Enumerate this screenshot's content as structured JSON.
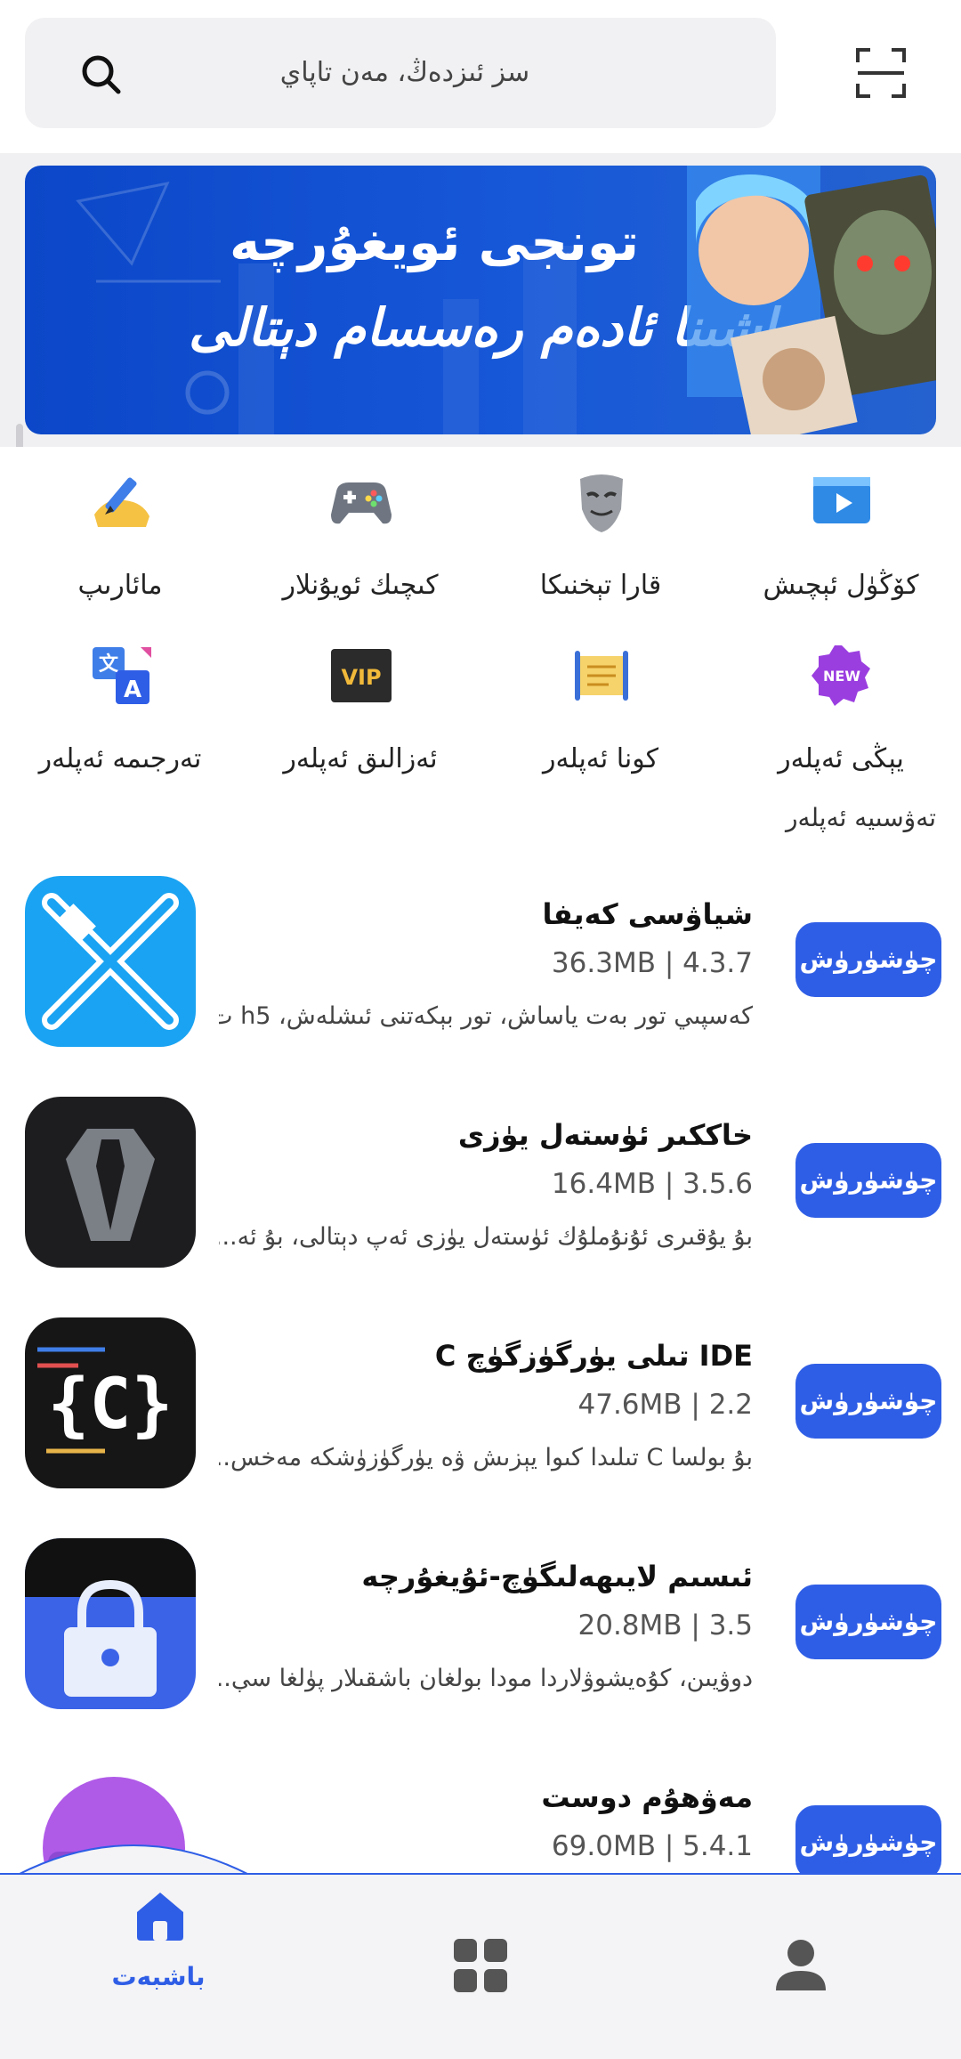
{
  "header": {
    "search_placeholder": "سز ئىزدەڭ، مەن تاپاي",
    "search_icon": "search-icon",
    "scan_icon": "scan-icon"
  },
  "banner": {
    "title": "تونجى ئويغۇرچە",
    "subtitle": "ماشىنا ئادەم رەسسام دېتالى"
  },
  "categories": [
    {
      "label": "كۆڭۈل ئېچىش",
      "icon": "video-icon"
    },
    {
      "label": "قارا تېخنىكا",
      "icon": "mask-icon"
    },
    {
      "label": "كىچىك ئويۇنلار",
      "icon": "gamepad-icon"
    },
    {
      "label": "مائارىپ",
      "icon": "pen-icon"
    },
    {
      "label": "يېڭى ئەپلەر",
      "icon": "new-badge-icon"
    },
    {
      "label": "كونا ئەپلەر",
      "icon": "scroll-icon"
    },
    {
      "label": "ئەزالىق ئەپلەر",
      "icon": "vip-icon"
    },
    {
      "label": "تەرجىمە ئەپلەر",
      "icon": "translate-icon"
    }
  ],
  "section_title": "تەۋسىيە ئەپلەر",
  "apps": [
    {
      "name": "شياۋسى كەيفا",
      "meta": "36.3MB | 4.3.7",
      "desc": "كەسپىي تور بەت ياساش، تور بېكەتنى ئىشلەش، h5 ت..",
      "button": "چۈشۈرۈش"
    },
    {
      "name": "خاككىر ئۈستەل يۈزى",
      "meta": "16.4MB | 3.5.6",
      "desc": "بۇ يۇقىرى ئۇنۇملۇك ئۈستەل يۈزى ئەپ دېتالى، بۇ ئە...",
      "button": "چۈشۈرۈش"
    },
    {
      "name": "IDE تىلى يۈرگۈزگۈچ C",
      "meta": "47.6MB | 2.2",
      "desc": "بۇ بولسا C تىلىدا كىوا يېزىش ۋە يۈرگۈزۈشكە مەخس...",
      "button": "چۈشۈرۈش"
    },
    {
      "name": "ئىسىم لايىھەلىگۈچ-ئۇيغۇرچە",
      "meta": "20.8MB | 3.5",
      "desc": "دوۋيىن، كۇەيشوۋلاردا مودا بولغان باشقىلار پۈلغا سې..",
      "button": "چۈشۈرۈش"
    },
    {
      "name": "مەۋھۇم دوست",
      "meta": "69.0MB | 5.4.1",
      "desc": "",
      "button": "چۈشۈرۈش"
    }
  ],
  "bottom_nav": {
    "home_label": "باشبەت",
    "home_icon": "home-icon",
    "apps_icon": "grid-icon",
    "profile_icon": "user-icon"
  },
  "colors": {
    "accent": "#2f5ee6",
    "banner": "#0b47c8"
  }
}
